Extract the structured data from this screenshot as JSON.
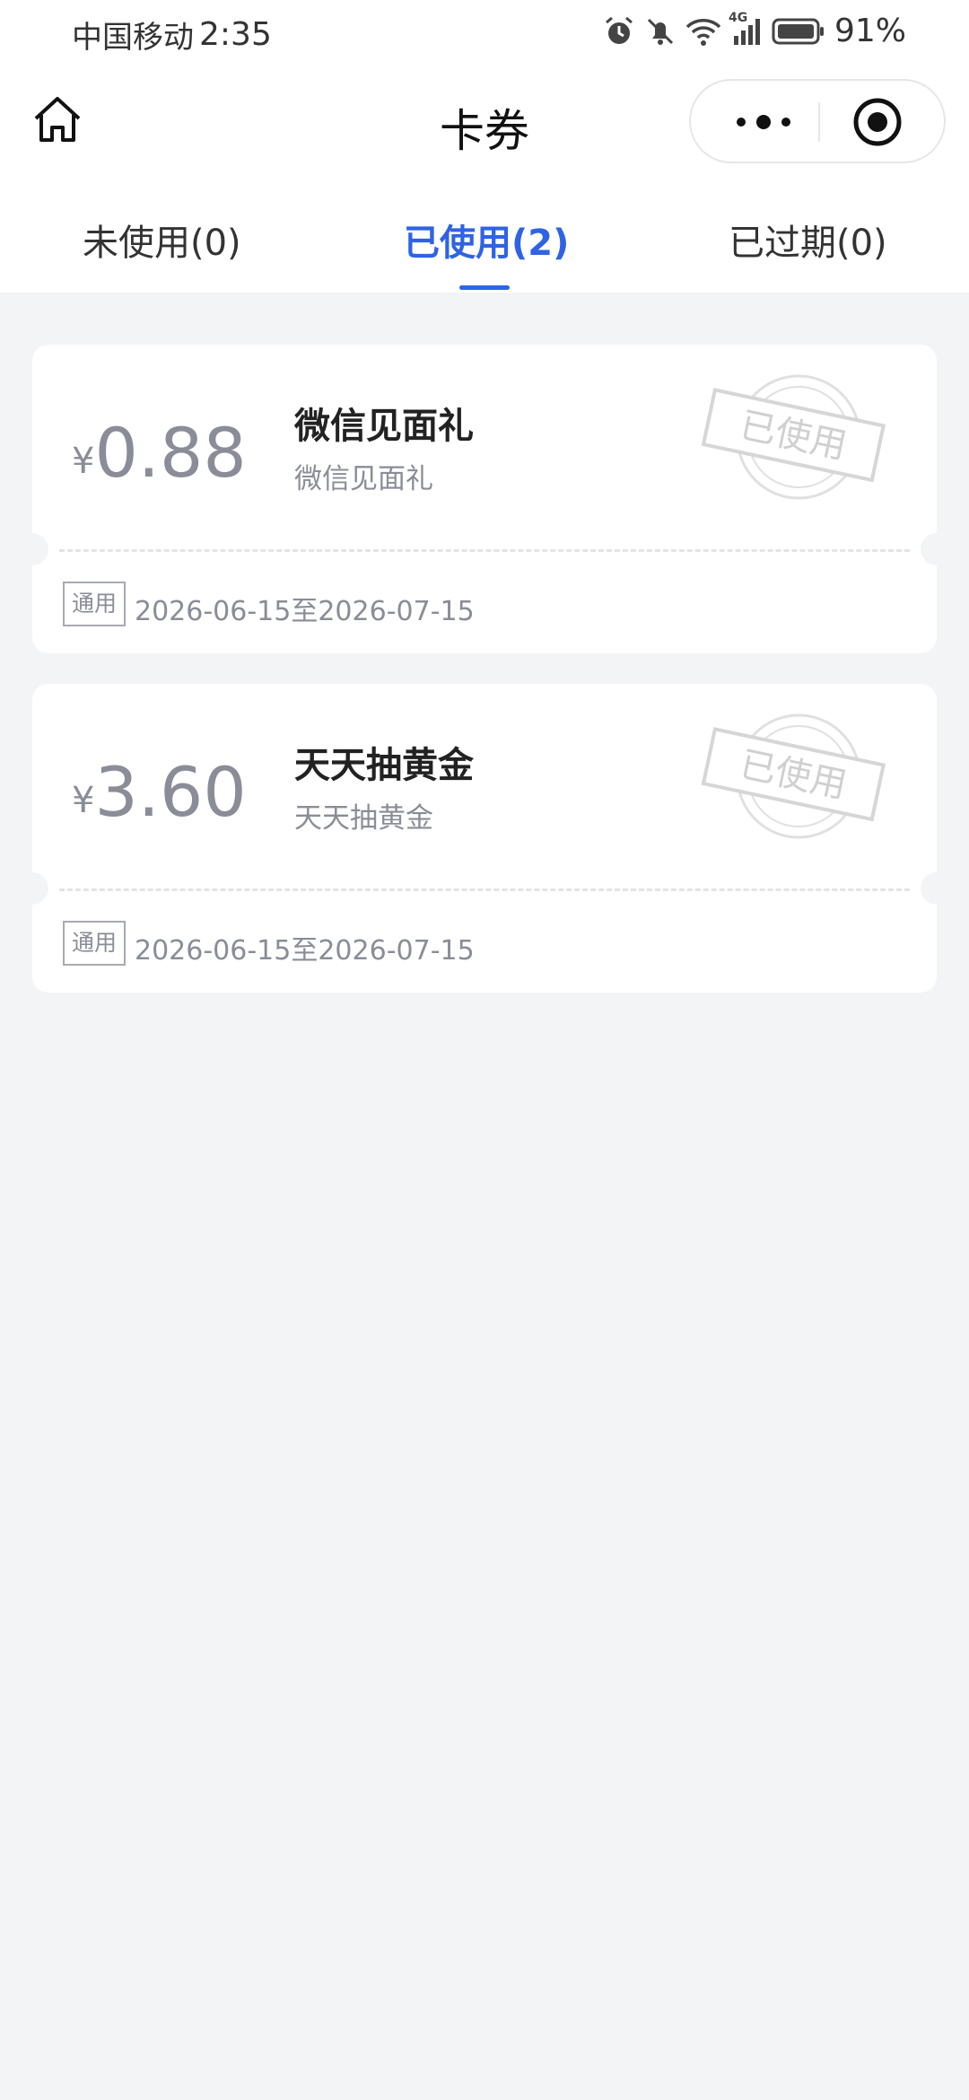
{
  "status_bar": {
    "carrier": "中国移动",
    "time": "2:35",
    "network": "4G",
    "battery": "91%"
  },
  "nav": {
    "title": "卡券"
  },
  "tabs": [
    {
      "label": "未使用(0)",
      "active": false
    },
    {
      "label": "已使用(2)",
      "active": true
    },
    {
      "label": "已过期(0)",
      "active": false
    }
  ],
  "coupons": [
    {
      "currency": "¥",
      "amount": "0.88",
      "name": "微信见面礼",
      "description": "微信见面礼",
      "tag": "通用",
      "validity": "2026-06-15至2026-07-15",
      "stamp": "已使用"
    },
    {
      "currency": "¥",
      "amount": "3.60",
      "name": "天天抽黄金",
      "description": "天天抽黄金",
      "tag": "通用",
      "validity": "2026-06-15至2026-07-15",
      "stamp": "已使用"
    }
  ],
  "colors": {
    "accent": "#2f63e6",
    "muted_text": "#8a8d98",
    "background": "#f3f4f6"
  }
}
